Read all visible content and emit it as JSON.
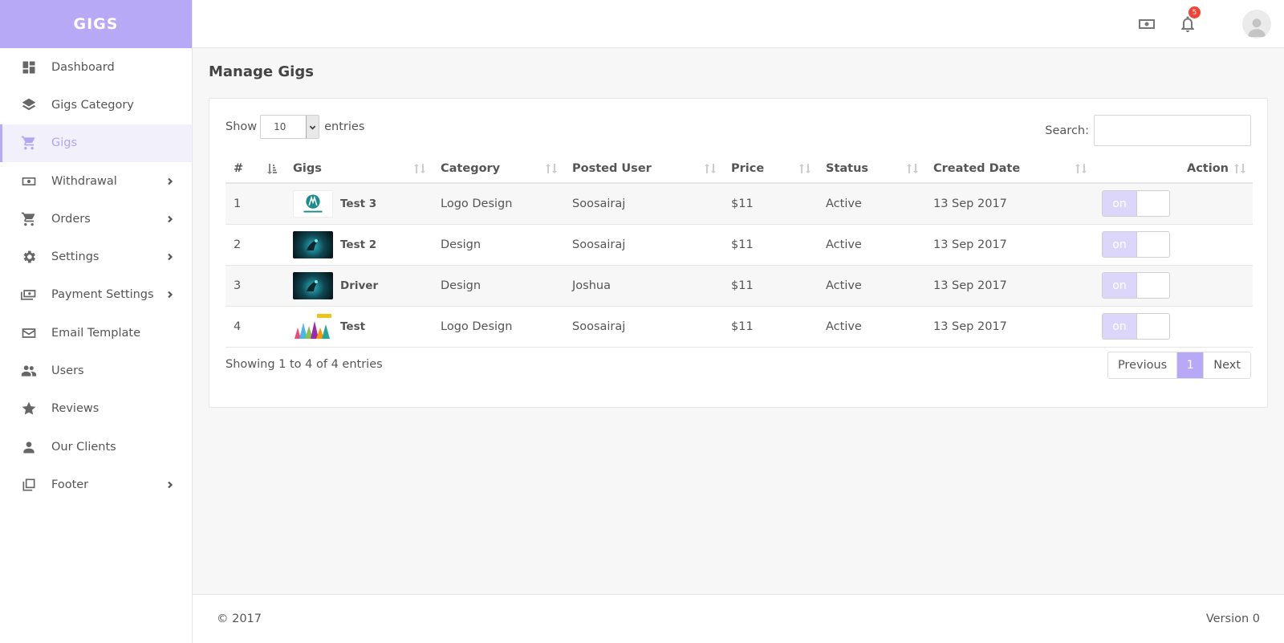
{
  "brand": "GIGS",
  "sidebar": {
    "items": [
      {
        "label": "Dashboard",
        "icon": "dashboard-icon",
        "chevron": false
      },
      {
        "label": "Gigs Category",
        "icon": "layers-icon",
        "chevron": false
      },
      {
        "label": "Gigs",
        "icon": "cart-icon",
        "chevron": false,
        "active": true
      },
      {
        "label": "Withdrawal",
        "icon": "money-icon",
        "chevron": true
      },
      {
        "label": "Orders",
        "icon": "cart-icon",
        "chevron": true
      },
      {
        "label": "Settings",
        "icon": "gear-icon",
        "chevron": true
      },
      {
        "label": "Payment Settings",
        "icon": "payment-icon",
        "chevron": true
      },
      {
        "label": "Email Template",
        "icon": "mail-icon",
        "chevron": false
      },
      {
        "label": "Users",
        "icon": "people-icon",
        "chevron": false
      },
      {
        "label": "Reviews",
        "icon": "star-icon",
        "chevron": false
      },
      {
        "label": "Our Clients",
        "icon": "person-icon",
        "chevron": false
      },
      {
        "label": "Footer",
        "icon": "library-icon",
        "chevron": true
      }
    ]
  },
  "topbar": {
    "notification_count": "5"
  },
  "main": {
    "title": "Manage Gigs",
    "show_label": "Show",
    "entries_value": "10",
    "entries_label": "entries",
    "search_label": "Search:",
    "search_value": "",
    "columns": [
      "#",
      "Gigs",
      "Category",
      "Posted User",
      "Price",
      "Status",
      "Created Date",
      "Action"
    ],
    "rows": [
      {
        "num": "1",
        "gig": "Test 3",
        "thumb": "logo",
        "category": "Logo Design",
        "user": "Soosairaj",
        "price": "$11",
        "status": "Active",
        "date": "13 Sep 2017",
        "toggle": "on"
      },
      {
        "num": "2",
        "gig": "Test 2",
        "thumb": "dark",
        "category": "Design",
        "user": "Soosairaj",
        "price": "$11",
        "status": "Active",
        "date": "13 Sep 2017",
        "toggle": "on"
      },
      {
        "num": "3",
        "gig": "Driver",
        "thumb": "dark",
        "category": "Design",
        "user": "Joshua",
        "price": "$11",
        "status": "Active",
        "date": "13 Sep 2017",
        "toggle": "on"
      },
      {
        "num": "4",
        "gig": "Test",
        "thumb": "color",
        "category": "Logo Design",
        "user": "Soosairaj",
        "price": "$11",
        "status": "Active",
        "date": "13 Sep 2017",
        "toggle": "on"
      }
    ],
    "info": "Showing 1 to 4 of 4 entries",
    "pagination": {
      "previous": "Previous",
      "current": "1",
      "next": "Next"
    }
  },
  "footer": {
    "copyright": "© 2017",
    "version": "Version 0"
  },
  "colors": {
    "accent": "#b8a9f7",
    "badge": "#f44336"
  }
}
